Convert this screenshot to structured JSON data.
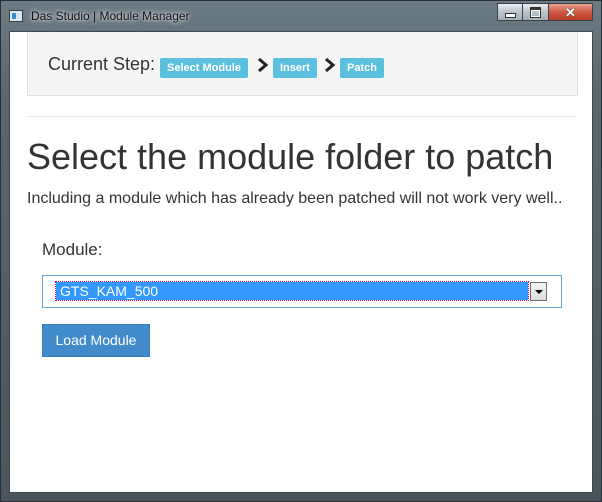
{
  "window": {
    "title": "Das Studio | Module Manager",
    "controls": {
      "minimize": "minimize",
      "maximize": "maximize",
      "close": "✕"
    }
  },
  "steps": {
    "label": "Current Step:",
    "items": [
      "Select Module",
      "Insert",
      "Patch"
    ]
  },
  "page": {
    "heading": "Select the module folder to patch",
    "subtext": "Including a module which has already been patched will not work very well.."
  },
  "form": {
    "module_label": "Module:",
    "module_selected": "GTS_KAM_500",
    "load_button": "Load Module"
  },
  "colors": {
    "badge": "#5bc0de",
    "primary_button": "#428bca",
    "selection": "#3399ff"
  }
}
